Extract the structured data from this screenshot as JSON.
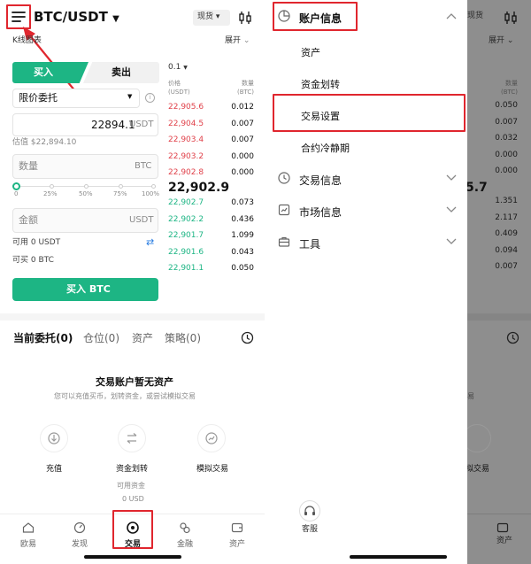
{
  "pair": "BTC/USDT",
  "spot_badge": "现货",
  "chart_link": "K线图表",
  "expand": "展开",
  "trade_tabs": {
    "buy": "买入",
    "sell": "卖出"
  },
  "order_type": "限价委托",
  "price_input": {
    "value": "22894.1",
    "unit": "USDT"
  },
  "estimate": "估值 $22,894.10",
  "qty_field": {
    "placeholder": "数量",
    "unit": "BTC"
  },
  "slider": {
    "level": 0,
    "marks": [
      "0",
      "25%",
      "50%",
      "75%",
      "100%"
    ]
  },
  "amount_field": {
    "placeholder": "金额",
    "unit": "USDT"
  },
  "available": {
    "usdt": "可用 0 USDT",
    "btc": "可买 0 BTC"
  },
  "buy_button": "买入 BTC",
  "orderbook": {
    "precision": "0.1",
    "price_header": [
      "价格",
      "(USDT)"
    ],
    "qty_header": [
      "数量",
      "(BTC)"
    ],
    "asks": [
      {
        "price": "22,905.6",
        "qty": "0.012"
      },
      {
        "price": "22,904.5",
        "qty": "0.007"
      },
      {
        "price": "22,903.4",
        "qty": "0.007"
      },
      {
        "price": "22,903.2",
        "qty": "0.000"
      },
      {
        "price": "22,902.8",
        "qty": "0.000"
      }
    ],
    "last_price": "22,902.9",
    "bids": [
      {
        "price": "22,902.7",
        "qty": "0.073"
      },
      {
        "price": "22,902.2",
        "qty": "0.436"
      },
      {
        "price": "22,901.7",
        "qty": "1.099"
      },
      {
        "price": "22,901.6",
        "qty": "0.043"
      },
      {
        "price": "22,901.1",
        "qty": "0.050"
      }
    ]
  },
  "order_tabs": [
    "当前委托(0)",
    "仓位(0)",
    "资产",
    "策略(0)"
  ],
  "empty": {
    "title": "交易账户暂无资产",
    "subtitle": "您可以充值买币，划转资金，或尝试模拟交易"
  },
  "actions": [
    {
      "label": "充值",
      "icon": "download-icon"
    },
    {
      "label": "资金划转",
      "icon": "transfer-icon"
    },
    {
      "label": "模拟交易",
      "icon": "simulate-icon"
    }
  ],
  "transfer_avail": {
    "label": "可用资金",
    "value": "0 USD"
  },
  "nav": [
    "欧易",
    "发现",
    "交易",
    "金融",
    "资产"
  ],
  "menu": {
    "account_info": "账户信息",
    "account_items": [
      "资产",
      "资金划转",
      "交易设置",
      "合约冷静期"
    ],
    "trade_info": "交易信息",
    "market_info": "市场信息",
    "tools": "工具",
    "support": "客服"
  },
  "right_bg": {
    "spot_badge": "现货",
    "expand": "展开",
    "qty_header": [
      "数量",
      "(BTC)"
    ],
    "ask_qty": [
      "0.050",
      "0.007",
      "0.032",
      "0.000",
      "0.000"
    ],
    "last_price_tail": "5.7",
    "bid_qty": [
      "1.351",
      "2.117",
      "0.409",
      "0.094",
      "0.007"
    ],
    "partial_text": "易",
    "partial_action": "拟交易",
    "nav_assets": "资产"
  },
  "colors": {
    "green": "#1db584",
    "red": "#e0414a",
    "annotation": "#e0262e"
  }
}
